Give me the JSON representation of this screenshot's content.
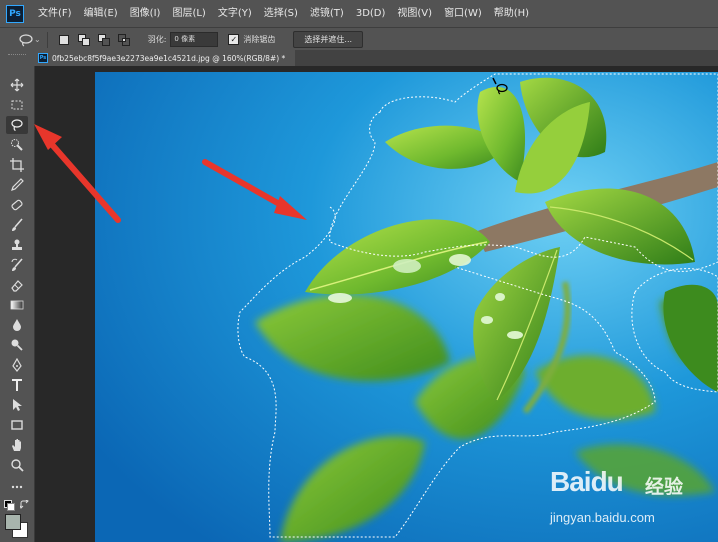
{
  "menubar": {
    "logo": "Ps",
    "items": [
      "文件(F)",
      "编辑(E)",
      "图像(I)",
      "图层(L)",
      "文字(Y)",
      "选择(S)",
      "滤镜(T)",
      "3D(D)",
      "视图(V)",
      "窗口(W)",
      "帮助(H)"
    ]
  },
  "options": {
    "feather_label": "羽化:",
    "feather_value": "0 像素",
    "antialias_label": "消除锯齿",
    "select_mask_label": "选择并遮住..."
  },
  "document_tab": {
    "logo": "Ps",
    "title": "0fb25ebc8f5f9ae3e2273ea9e1c4521d.jpg @ 160%(RGB/8#) *"
  },
  "watermark": {
    "brand": "Baidu",
    "brand_cn": "经验",
    "url": "jingyan.baidu.com"
  },
  "colors": {
    "ui_bg": "#535353",
    "workspace": "#282828",
    "annotation_arrow": "#e8362b",
    "sky_blue": "#1e8fd4",
    "leaf_green": "#7cc23a"
  },
  "icons": [
    "move-icon",
    "marquee-icon",
    "lasso-icon",
    "quick-select-icon",
    "crop-icon",
    "eyedropper-icon",
    "healing-brush-icon",
    "brush-icon",
    "stamp-icon",
    "history-brush-icon",
    "eraser-icon",
    "gradient-icon",
    "blur-icon",
    "dodge-icon",
    "pen-icon",
    "type-icon",
    "path-select-icon",
    "rectangle-icon",
    "hand-icon",
    "zoom-icon",
    "more-icon"
  ]
}
